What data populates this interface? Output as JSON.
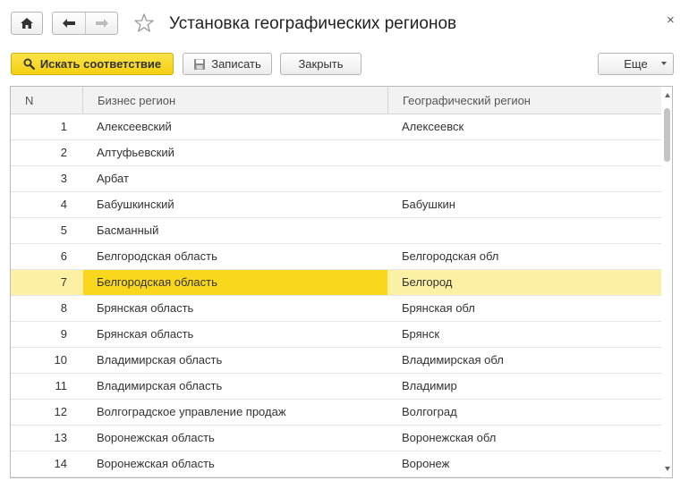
{
  "window": {
    "title": "Установка географических регионов",
    "close_glyph": "×"
  },
  "toolbar": {
    "find_label": "Искать соответствие",
    "save_label": "Записать",
    "close_label": "Закрыть",
    "more_label": "Еще"
  },
  "table": {
    "columns": [
      "N",
      "Бизнес регион",
      "Географический регион"
    ],
    "selected_row": 7,
    "rows": [
      {
        "n": "1",
        "business": "Алексеевский",
        "geo": "Алексеевск"
      },
      {
        "n": "2",
        "business": "Алтуфьевский",
        "geo": ""
      },
      {
        "n": "3",
        "business": "Арбат",
        "geo": ""
      },
      {
        "n": "4",
        "business": "Бабушкинский",
        "geo": "Бабушкин"
      },
      {
        "n": "5",
        "business": "Басманный",
        "geo": ""
      },
      {
        "n": "6",
        "business": "Белгородская область",
        "geo": "Белгородская обл"
      },
      {
        "n": "7",
        "business": "Белгородская область",
        "geo": "Белгород"
      },
      {
        "n": "8",
        "business": "Брянская область",
        "geo": "Брянская обл"
      },
      {
        "n": "9",
        "business": "Брянская область",
        "geo": "Брянск"
      },
      {
        "n": "10",
        "business": "Владимирская область",
        "geo": "Владимирская обл"
      },
      {
        "n": "11",
        "business": "Владимирская область",
        "geo": "Владимир"
      },
      {
        "n": "12",
        "business": "Волгоградское управление продаж",
        "geo": "Волгоград"
      },
      {
        "n": "13",
        "business": "Воронежская область",
        "geo": "Воронежская обл"
      },
      {
        "n": "14",
        "business": "Воронежская область",
        "geo": "Воронеж"
      }
    ]
  },
  "icons": {
    "home": "home-icon",
    "back": "arrow-left-icon",
    "forward": "arrow-right-icon",
    "favorite": "star-icon",
    "search": "search-icon",
    "save": "save-icon"
  },
  "colors": {
    "accent_yellow": "#f9d71c",
    "selected_row": "#fbf0a4"
  }
}
